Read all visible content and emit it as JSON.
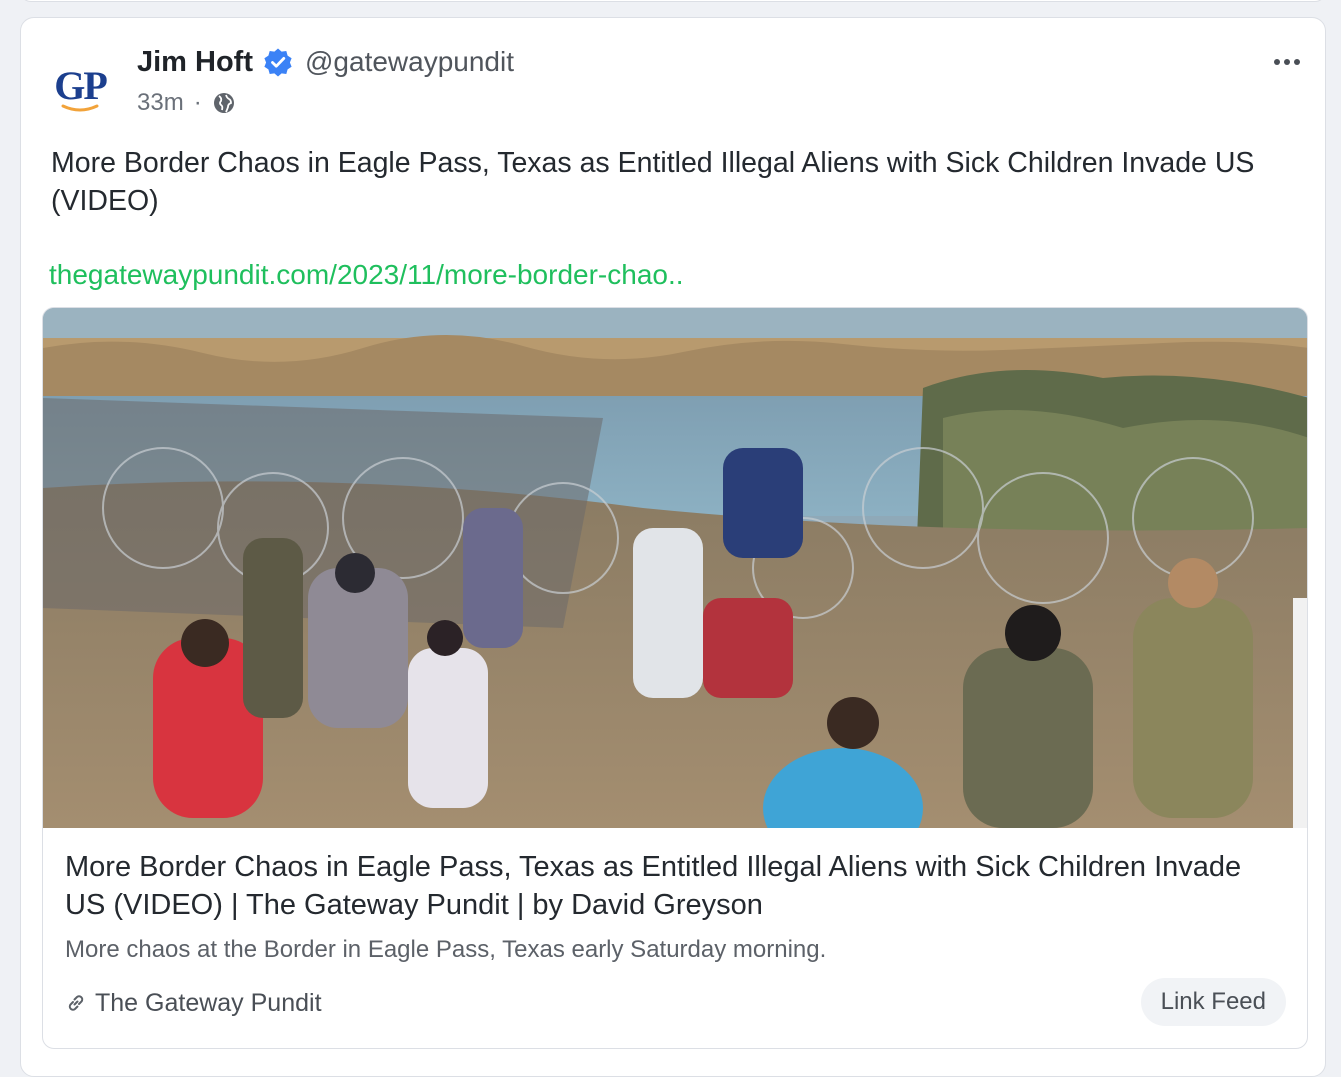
{
  "post": {
    "avatar_text": "GP",
    "author_name": "Jim Hoft",
    "handle": "@gatewaypundit",
    "time_ago": "33m",
    "separator": "·",
    "text": "More Border Chaos in Eagle Pass, Texas as Entitled Illegal Aliens with Sick Children Invade US (VIDEO)",
    "link_text": "thegatewaypundit.com/2023/11/more-border-chao..",
    "icons": {
      "verified": "verified-badge-icon",
      "visibility": "globe-icon",
      "more": "more-options-icon",
      "link": "chain-link-icon"
    }
  },
  "link_card": {
    "title": "More Border Chaos in Eagle Pass, Texas as Entitled Illegal Aliens with Sick Children Invade US (VIDEO) | The Gateway Pundit | by David Greyson",
    "description": "More chaos at the Border in Eagle Pass, Texas early Saturday morning.",
    "source": "The Gateway Pundit",
    "button_label": "Link Feed"
  },
  "colors": {
    "link_green": "#1fbf5d",
    "verified_blue": "#3b82f6",
    "avatar_blue": "#1c3f8e",
    "avatar_swoosh": "#f2a33a"
  }
}
